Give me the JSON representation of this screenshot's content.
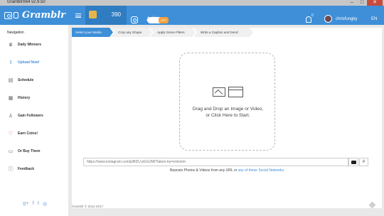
{
  "window": {
    "title": "GramblrX64 v2.9.50",
    "minimize": "–",
    "maximize": "□",
    "close": "✕"
  },
  "header": {
    "brand": "Gramblr",
    "coins": "390",
    "toggle_label": "OFF",
    "notif_count": "0",
    "username": "chrisfungky",
    "lang": "EN",
    "user_glyph": "♙",
    "heart_glyph": "♡"
  },
  "sidebar": {
    "title": "Navigation",
    "items": [
      {
        "label": "Daily Winners",
        "icon": "trophy-icon",
        "glyph": "♛"
      },
      {
        "label": "Upload Now!",
        "icon": "upload-icon",
        "glyph": "⇧"
      },
      {
        "label": "Schedule",
        "icon": "schedule-icon",
        "glyph": "▤"
      },
      {
        "label": "History",
        "icon": "history-icon",
        "glyph": "▦"
      },
      {
        "label": "Gain Followers",
        "icon": "followers-icon",
        "glyph": "♙"
      },
      {
        "label": "Earn Coins!",
        "icon": "heart-icon",
        "glyph": "♡"
      },
      {
        "label": "Or Buy Them",
        "icon": "card-icon",
        "glyph": "▭"
      },
      {
        "label": "Feedback",
        "icon": "info-icon",
        "glyph": "ⓘ"
      }
    ],
    "social": [
      "g+",
      "f",
      "t",
      "◎"
    ]
  },
  "steps": [
    "Select your Media",
    "Crop any Shape",
    "Apply Some Filters",
    "Write a Caption and Send"
  ],
  "dropzone": {
    "line1": "Drag and Drop an Image or Video,",
    "line2": "or Click Here to Start."
  },
  "url": {
    "placeholder": "https://www.instagram.com/p/BDU-jnlLb2M/?taken-by=eminem",
    "hash": "#"
  },
  "reposts": {
    "text": "Reposts Photos & Videos from any URL or ",
    "link": "any of these Social Networks"
  },
  "footer": {
    "text": "Gramblr © 2011-2017"
  },
  "colors": {
    "accent": "#3e8fd8",
    "coin": "#e8b54a",
    "toggle": "#f3a23b"
  }
}
